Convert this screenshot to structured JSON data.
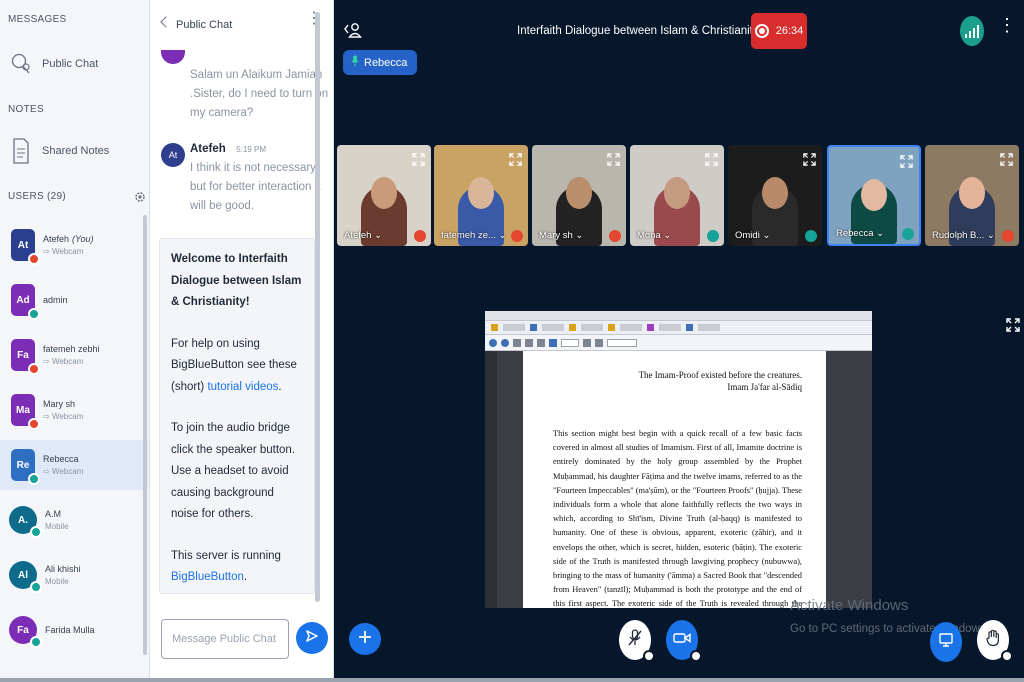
{
  "sidebar": {
    "messages_title": "MESSAGES",
    "public_chat": "Public Chat",
    "notes_title": "NOTES",
    "shared_notes": "Shared Notes",
    "users_title": "USERS (29)",
    "users": [
      {
        "initials": "At",
        "name": "Atefeh",
        "you": "(You)",
        "sub": "Webcam",
        "color": "#2c3e8f",
        "status_color": "#e4472e"
      },
      {
        "initials": "Ad",
        "name": "admin",
        "sub": "",
        "color": "#7b2db5",
        "status_color": "#17a398"
      },
      {
        "initials": "Fa",
        "name": "fatemeh zebhi",
        "sub": "Webcam",
        "color": "#7b2db5",
        "status_color": "#e4472e"
      },
      {
        "initials": "Ma",
        "name": "Mary sh",
        "sub": "Webcam",
        "color": "#7b2db5",
        "status_color": "#e4472e"
      },
      {
        "initials": "Re",
        "name": "Rebecca",
        "sub": "Webcam",
        "color": "#2e6fc4",
        "status_color": "#17a398"
      },
      {
        "initials": "A.",
        "name": "A.M",
        "sub": "Mobile",
        "color": "#0f6b8c",
        "status_color": "#17a398"
      },
      {
        "initials": "Al",
        "name": "Ali khishi",
        "sub": "Mobile",
        "color": "#0f6b8c",
        "status_color": "#17a398"
      },
      {
        "initials": "Fa",
        "name": "Farida Mulla",
        "sub": "",
        "color": "#7b2db5",
        "status_color": "#17a398"
      }
    ]
  },
  "chat": {
    "title": "Public Chat",
    "msg1": [
      "Salam un Alaikum Jamian",
      ".Sister, do I need to turn on",
      "my camera?"
    ],
    "msg2_author": "Atefeh",
    "msg2_time": "5:19 PM",
    "msg2_avatar": "At",
    "msg2": [
      "I think it is not necessary.",
      "but for better interaction it",
      "will be good."
    ],
    "welcome_title": "Welcome to Interfaith Dialogue between Islam & Christianity!",
    "help_prefix": "For help on using BigBlueButton see these (short)",
    "help_link": "tutorial videos",
    "help_suffix": ".",
    "audio_text": "To join the audio bridge click the speaker button. Use a headset to avoid causing background noise for others.",
    "server_prefix": "This server is running",
    "server_link": "BigBlueButton",
    "server_suffix": ".",
    "input_placeholder": "Message Public Chat"
  },
  "main": {
    "meeting_title": "Interfaith Dialogue between Islam & Christianity",
    "recording_time": "26:34",
    "talker": "Rebecca",
    "tiles": [
      {
        "name": "Atefeh",
        "bg": "#d8d2c9",
        "skin": "#c99a78",
        "cloth": "#6a3b2e",
        "mic": "#e4472e"
      },
      {
        "name": "fatemeh ze...",
        "bg": "#c9a364",
        "skin": "#d9b69a",
        "cloth": "#3a5aa8",
        "mic": "#e4472e"
      },
      {
        "name": "Mary sh",
        "bg": "#b9b6ae",
        "skin": "#b88e6c",
        "cloth": "#222222",
        "mic": "#e4472e"
      },
      {
        "name": "Mona",
        "bg": "#cfcbc6",
        "skin": "#c49a80",
        "cloth": "#9a4a4a",
        "mic": "#17a398"
      },
      {
        "name": "Omidi",
        "bg": "#1c1c1c",
        "skin": "#b98a6a",
        "cloth": "#2a2a2a",
        "mic": "#17a398"
      },
      {
        "name": "Rebecca",
        "bg": "#7ea2bf",
        "skin": "#e0b9a0",
        "cloth": "#0e4a44",
        "mic": "#17a398"
      },
      {
        "name": "Rudolph B...",
        "bg": "#8d7a63",
        "skin": "#e3b49a",
        "cloth": "#2f3d5c",
        "mic": "#e4472e"
      }
    ],
    "doc_quote_1": "The Imam-Proof existed before the creatures.",
    "doc_quote_2": "Imam Ja'far al-Sādiq",
    "doc_body": "This section might best begin with a quick recall of a few basic facts covered in almost all studies of Imamism. First of all, Imamite doctrine is entirely dominated by the holy group assembled by the Prophet Muḥammad, his daughter Fāṭima and the twelve imams, referred to as the \"Fourteen Impeccables\" (ma'ṣūm), or the \"Fourteen Proofs\" (ḥujja). These individuals form a whole that alone faithfully reflects the two ways in which, according to Shī'ism, Divine Truth (al-ḥaqq) is manifested to humanity. One of these is obvious, apparent, exoteric (ẓāhir), and it envelops the other, which is secret, hidden, esoteric (bāṭin). The exoteric side of the Truth is manifested through lawgiving prophecy (nubuwwa), bringing to the mass of humanity ('āmma) a Sacred Book that \"descended from Heaven\" (tanzīl); Muḥammad is both the prototype and the end of this first aspect. The exoteric side of the Truth is revealed through the mission of the imams (walāya), accompanying each",
    "watermark_title": "Activate Windows",
    "watermark_sub": "Go to PC settings to activate Windows."
  },
  "colors": {
    "accent": "#1a73e8",
    "record": "#d92d2d",
    "background": "#06172b"
  }
}
